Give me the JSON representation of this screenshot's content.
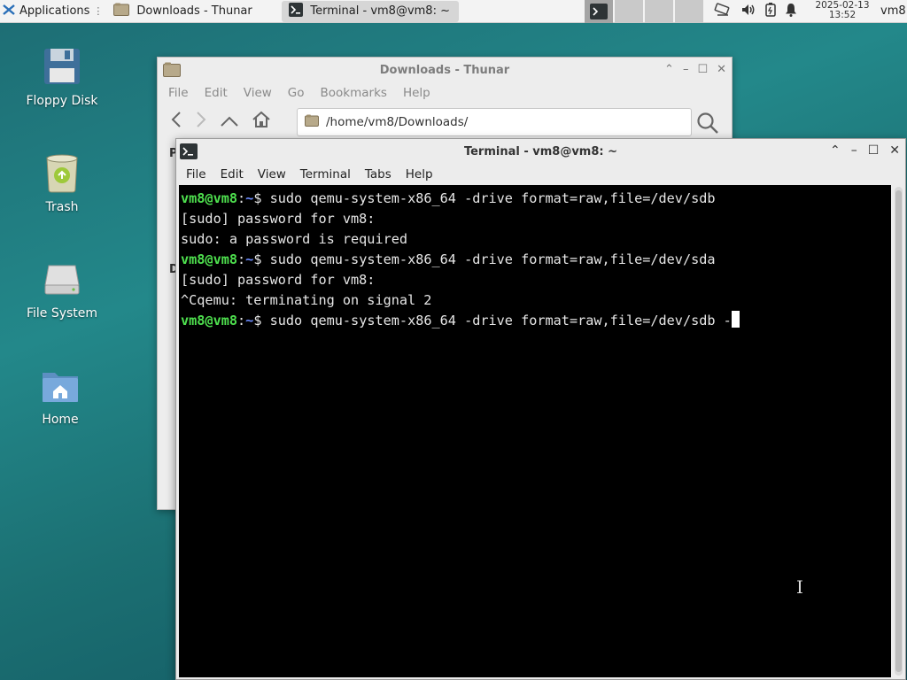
{
  "panel": {
    "applications_label": "Applications",
    "tasks": [
      {
        "label": "Downloads - Thunar"
      },
      {
        "label": "Terminal - vm8@vm8: ~"
      }
    ],
    "clock_date": "2025-02-13",
    "clock_time": "13:52",
    "user": "vm8"
  },
  "desktop": {
    "icons": [
      {
        "label": "Floppy Disk",
        "icon": "floppy-disk-icon"
      },
      {
        "label": "Trash",
        "icon": "trash-icon"
      },
      {
        "label": "File System",
        "icon": "drive-icon"
      },
      {
        "label": "Home",
        "icon": "home-folder-icon"
      }
    ]
  },
  "thunar": {
    "title": "Downloads - Thunar",
    "menu": [
      "File",
      "Edit",
      "View",
      "Go",
      "Bookmarks",
      "Help"
    ],
    "path": "/home/vm8/Downloads/",
    "side_letters": [
      "P",
      "D"
    ]
  },
  "terminal": {
    "title": "Terminal - vm8@vm8: ~",
    "menu": [
      "File",
      "Edit",
      "View",
      "Terminal",
      "Tabs",
      "Help"
    ],
    "prompt_user": "vm8@vm8",
    "prompt_sep": ":",
    "prompt_path": "~",
    "prompt_sym": "$",
    "lines": [
      {
        "type": "prompt",
        "cmd": "sudo qemu-system-x86_64 -drive format=raw,file=/dev/sdb"
      },
      {
        "type": "out",
        "text": "[sudo] password for vm8:"
      },
      {
        "type": "out",
        "text": "sudo: a password is required"
      },
      {
        "type": "prompt",
        "cmd": "sudo qemu-system-x86_64 -drive format=raw,file=/dev/sda"
      },
      {
        "type": "out",
        "text": "[sudo] password for vm8:"
      },
      {
        "type": "out",
        "text": "^Cqemu: terminating on signal 2"
      },
      {
        "type": "prompt",
        "cmd": "sudo qemu-system-x86_64 -drive format=raw,file=/dev/sdb -",
        "cursor": true
      }
    ]
  }
}
